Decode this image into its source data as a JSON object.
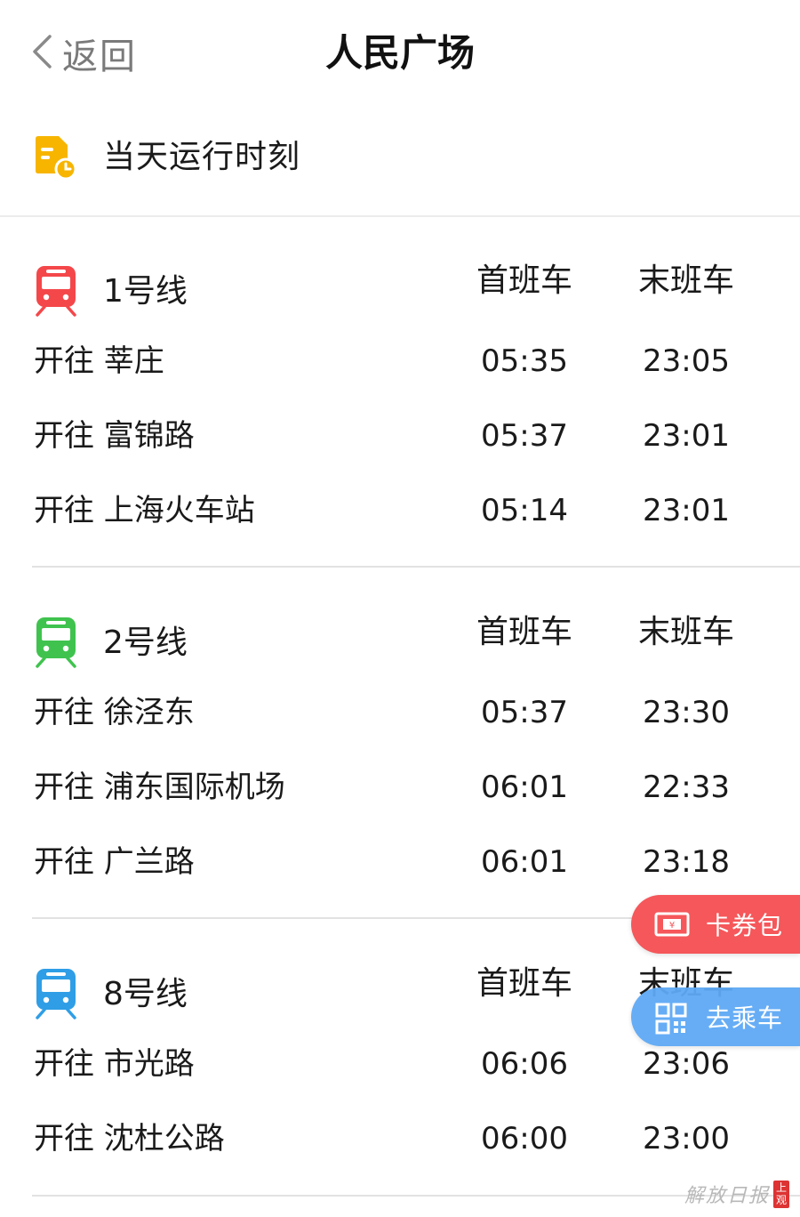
{
  "nav": {
    "back_label": "返回",
    "title": "人民广场"
  },
  "schedule_header": {
    "label": "当天运行时刻",
    "icon": "schedule-doc-clock-icon"
  },
  "columns": {
    "first": "首班车",
    "last": "末班车"
  },
  "lines": [
    {
      "name": "1号线",
      "color": "#f4474a",
      "icon": "train-icon",
      "rows": [
        {
          "dest": "开往 莘庄",
          "first": "05:35",
          "last": "23:05"
        },
        {
          "dest": "开往 富锦路",
          "first": "05:37",
          "last": "23:01"
        },
        {
          "dest": "开往 上海火车站",
          "first": "05:14",
          "last": "23:01"
        }
      ]
    },
    {
      "name": "2号线",
      "color": "#3fc34e",
      "icon": "train-icon",
      "rows": [
        {
          "dest": "开往 徐泾东",
          "first": "05:37",
          "last": "23:30"
        },
        {
          "dest": "开往 浦东国际机场",
          "first": "06:01",
          "last": "22:33"
        },
        {
          "dest": "开往 广兰路",
          "first": "06:01",
          "last": "23:18"
        }
      ]
    },
    {
      "name": "8号线",
      "color": "#2f9ee6",
      "icon": "train-icon",
      "rows": [
        {
          "dest": "开往 市光路",
          "first": "06:06",
          "last": "23:06"
        },
        {
          "dest": "开往 沈杜公路",
          "first": "06:00",
          "last": "23:00"
        }
      ]
    }
  ],
  "floating": {
    "coupon_label": "卡券包",
    "coupon_icon": "ticket-icon",
    "ride_label": "去乘车",
    "ride_icon": "qr-code-icon"
  },
  "watermark": {
    "text": "解放日报",
    "seal": "上观"
  },
  "colors": {
    "schedule_icon": "#f7b500",
    "coupon_bg": "#f5575a",
    "ride_bg": "#5ea9f5"
  }
}
